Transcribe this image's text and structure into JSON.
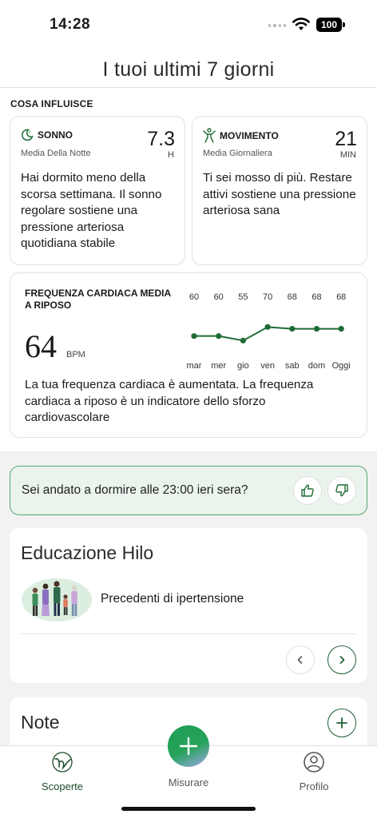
{
  "status_bar": {
    "time": "14:28",
    "battery": "100"
  },
  "header": {
    "title": "I tuoi ultimi 7 giorni"
  },
  "influences": {
    "section_title": "COSA INFLUISCE",
    "sleep": {
      "label": "SONNO",
      "subtitle": "Media Della Notte",
      "value": "7.3",
      "unit": "H",
      "description": "Hai dormito meno della scorsa settimana. Il sonno regolare sostiene una pressione arteriosa quotidiana stabile"
    },
    "movement": {
      "label": "MOVIMENTO",
      "subtitle": "Media Giornaliera",
      "value": "21",
      "unit": "MIN",
      "description": "Ti sei mosso di più. Restare attivi sostiene una pressione arteriosa sana"
    },
    "heart_rate": {
      "title": "FREQUENZA CARDIACA MEDIA A RIPOSO",
      "value": "64",
      "unit": "BPM",
      "description": "La tua frequenza cardiaca è aumentata. La frequenza cardiaca a riposo è un indicatore dello sforzo cardiovascolare"
    }
  },
  "chart_data": {
    "type": "line",
    "categories": [
      "mar",
      "mer",
      "gio",
      "ven",
      "sab",
      "dom",
      "Oggi"
    ],
    "values": [
      60,
      60,
      55,
      70,
      68,
      68,
      68
    ],
    "title": "",
    "xlabel": "",
    "ylabel": "",
    "color": "#1e6b37"
  },
  "question": {
    "prefix": "Sei andato a dormire alle ",
    "time": "23:00",
    "suffix": " ieri sera?"
  },
  "education": {
    "title": "Educazione Hilo",
    "item_label": "Precedenti di ipertensione"
  },
  "notes": {
    "title": "Note"
  },
  "tabbar": {
    "items": [
      {
        "label": "Scoperte",
        "icon": "hilo-logo-icon"
      },
      {
        "label": "Misurare",
        "icon": "plus-icon"
      },
      {
        "label": "Profilo",
        "icon": "user-icon"
      }
    ]
  },
  "colors": {
    "accent": "#1e6b37",
    "question_bg": "#eaf4ed",
    "question_border": "#5aa46e"
  }
}
